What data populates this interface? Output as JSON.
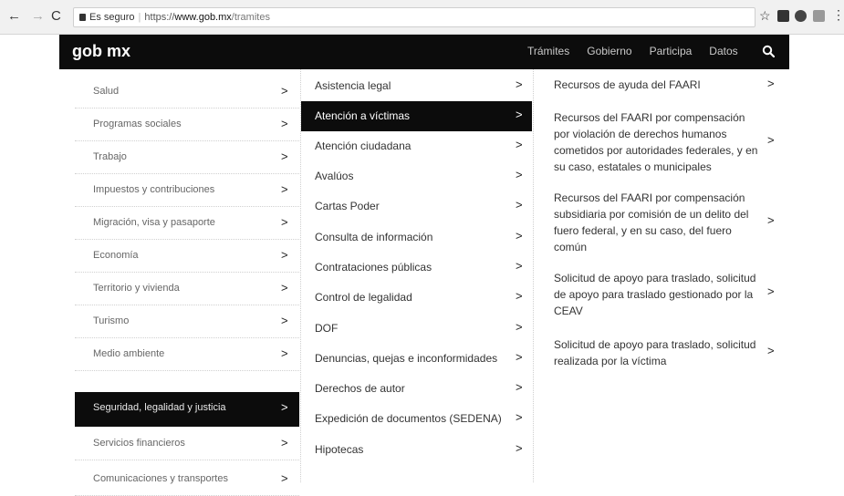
{
  "browser": {
    "back": "←",
    "forward": "→",
    "reload": "C",
    "secure_label": "Es seguro",
    "url_proto": "https://",
    "url_host": "www.gob.mx",
    "url_path": "/tramites",
    "star": "☆",
    "menu": "⋮"
  },
  "header": {
    "brand": "gob mx",
    "nav": [
      "Trámites",
      "Gobierno",
      "Participa",
      "Datos"
    ],
    "search_icon": "search-icon"
  },
  "categories": [
    "Salud",
    "Programas sociales",
    "Trabajo",
    "Impuestos y contribuciones",
    "Migración, visa y pasaporte",
    "Economía",
    "Territorio y vivienda",
    "Turismo",
    "Medio ambiente",
    "Seguridad, legalidad y justicia",
    "Servicios financieros",
    "Comunicaciones y transportes"
  ],
  "active_category": "Seguridad, legalidad y justicia",
  "subcategories": [
    "Asistencia legal",
    "Atención a víctimas",
    "Atención ciudadana",
    "Avalúos",
    "Cartas Poder",
    "Consulta de información",
    "Contrataciones públicas",
    "Control de legalidad",
    "DOF",
    "Denuncias, quejas e inconformidades",
    "Derechos de autor",
    "Expedición de documentos (SEDENA)",
    "Hipotecas"
  ],
  "active_subcategory": "Atención a víctimas",
  "procedures": [
    "Recursos de ayuda del FAARI",
    "Recursos del FAARI por compensación por violación de derechos humanos cometidos por autoridades federales, y en su caso, estatales o municipales",
    "Recursos del FAARI por compensación subsidiaria por comisión de un delito del fuero federal, y en su caso, del fuero común",
    "Solicitud de apoyo para traslado, solicitud de apoyo para traslado gestionado por la CEAV",
    "Solicitud de apoyo para traslado, solicitud realizada por la víctima"
  ],
  "chevron": ">"
}
